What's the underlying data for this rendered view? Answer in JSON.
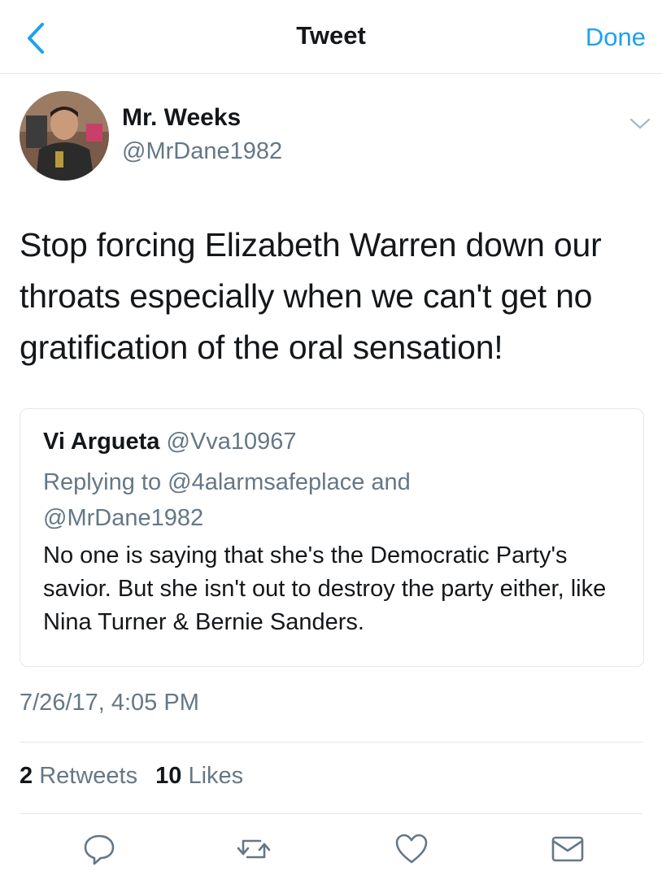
{
  "nav": {
    "title": "Tweet",
    "done_label": "Done"
  },
  "author": {
    "display_name": "Mr. Weeks",
    "handle": "@MrDane1982"
  },
  "tweet": {
    "text": "Stop forcing Elizabeth Warren down our throats especially when we can't get no gratification of the oral sensation!",
    "timestamp": "7/26/17, 4:05 PM"
  },
  "quoted": {
    "name": "Vi Argueta",
    "handle": "@Vva10967",
    "reply_line1": "Replying to @4alarmsafeplace and",
    "reply_line2": "@MrDane1982",
    "text": "No one is saying that she's the Democratic Party's savior. But she isn't out to destroy the party either, like Nina Turner & Bernie Sanders."
  },
  "stats": {
    "retweets": "2",
    "retweets_label": "Retweets",
    "likes": "10",
    "likes_label": "Likes"
  },
  "icons": {
    "back": "chevron-left-icon",
    "caret": "chevron-down-icon",
    "reply": "reply-icon",
    "retweet": "retweet-icon",
    "like": "heart-icon",
    "dm": "envelope-icon"
  },
  "colors": {
    "accent": "#1da1f2",
    "secondary_text": "#657786",
    "divider": "#e1e8ed",
    "icon": "#657786"
  }
}
